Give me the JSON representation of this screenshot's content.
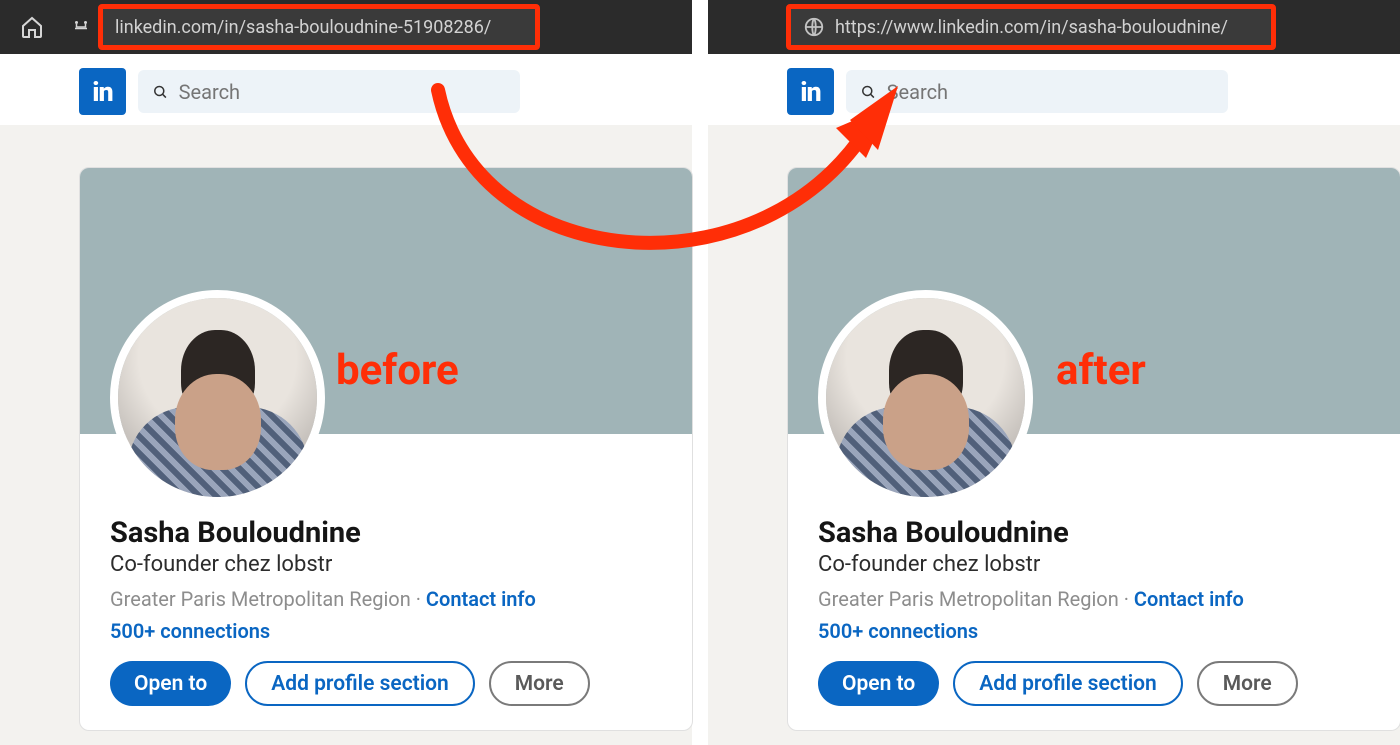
{
  "annotations": {
    "before_label": "before",
    "after_label": "after"
  },
  "browser": {
    "left_url": "linkedin.com/in/sasha-bouloudnine-51908286/",
    "right_url": "https://www.linkedin.com/in/sasha-bouloudnine/"
  },
  "logo_text": "in",
  "search": {
    "placeholder": "Search"
  },
  "profile": {
    "name": "Sasha Bouloudnine",
    "headline": "Co-founder chez lobstr",
    "location": "Greater Paris Metropolitan Region",
    "separator": " · ",
    "contact_label": "Contact info",
    "connections": "500+ connections",
    "buttons": {
      "open_to": "Open to",
      "add_section": "Add profile section",
      "more": "More"
    }
  }
}
